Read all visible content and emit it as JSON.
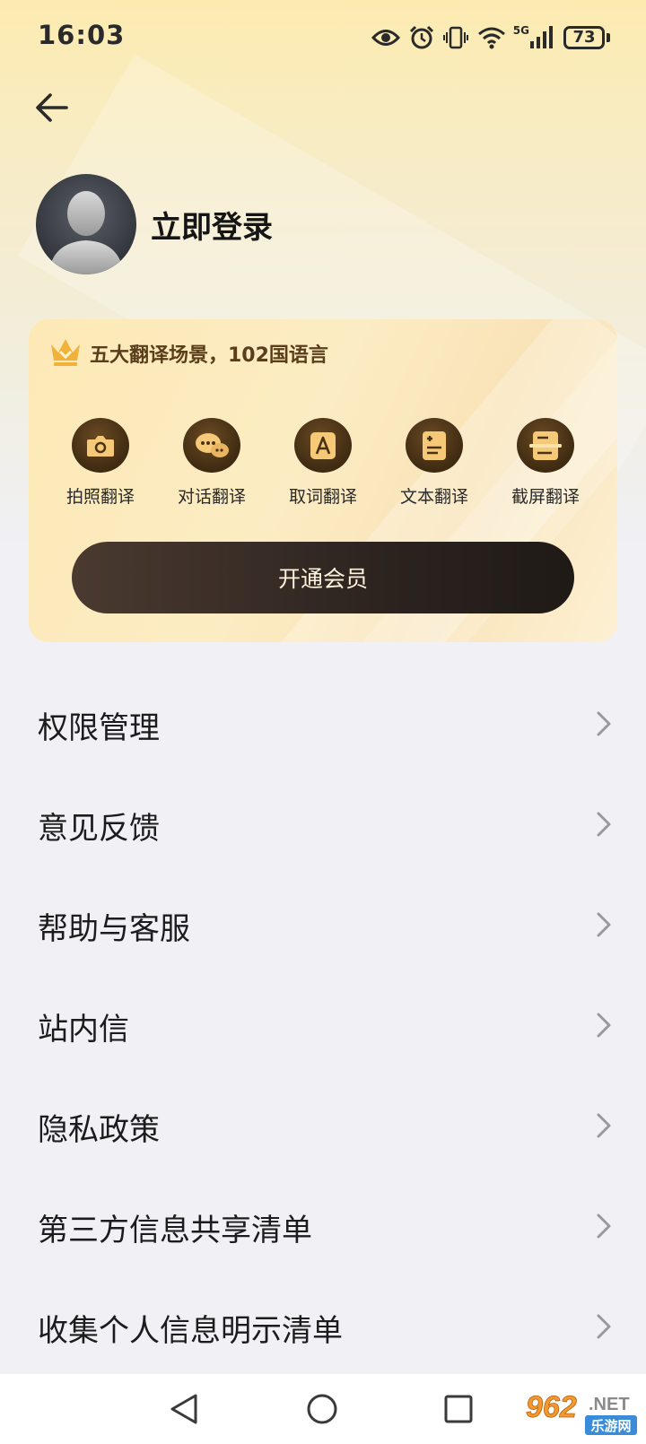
{
  "status_bar": {
    "time": "16:03",
    "network": "5G",
    "battery": "73",
    "icons": [
      "eye-icon",
      "alarm-icon",
      "vibrate-icon",
      "wifi-icon",
      "signal-icon",
      "battery-icon"
    ]
  },
  "header": {
    "back_icon": "arrow-left-icon"
  },
  "profile": {
    "login_label": "立即登录"
  },
  "vip_card": {
    "slogan": "五大翻译场景，102国语言",
    "features": [
      {
        "label": "拍照翻译",
        "icon": "camera-icon"
      },
      {
        "label": "对话翻译",
        "icon": "chat-bubbles-icon"
      },
      {
        "label": "取词翻译",
        "icon": "letter-a-icon"
      },
      {
        "label": "文本翻译",
        "icon": "document-text-icon"
      },
      {
        "label": "截屏翻译",
        "icon": "screenshot-icon"
      }
    ],
    "button_label": "开通会员",
    "colors": {
      "accent": "#3f2b12",
      "button": "#2d2420"
    }
  },
  "menu": {
    "items": [
      {
        "label": "权限管理"
      },
      {
        "label": "意见反馈"
      },
      {
        "label": "帮助与客服"
      },
      {
        "label": "站内信"
      },
      {
        "label": "隐私政策"
      },
      {
        "label": "第三方信息共享清单"
      },
      {
        "label": "收集个人信息明示清单"
      }
    ]
  },
  "nav_bar": {
    "icons": [
      "nav-back-icon",
      "nav-home-icon",
      "nav-recents-icon"
    ]
  },
  "watermark": {
    "brand": "962",
    "suffix": ".NET",
    "caption": "乐游网"
  }
}
